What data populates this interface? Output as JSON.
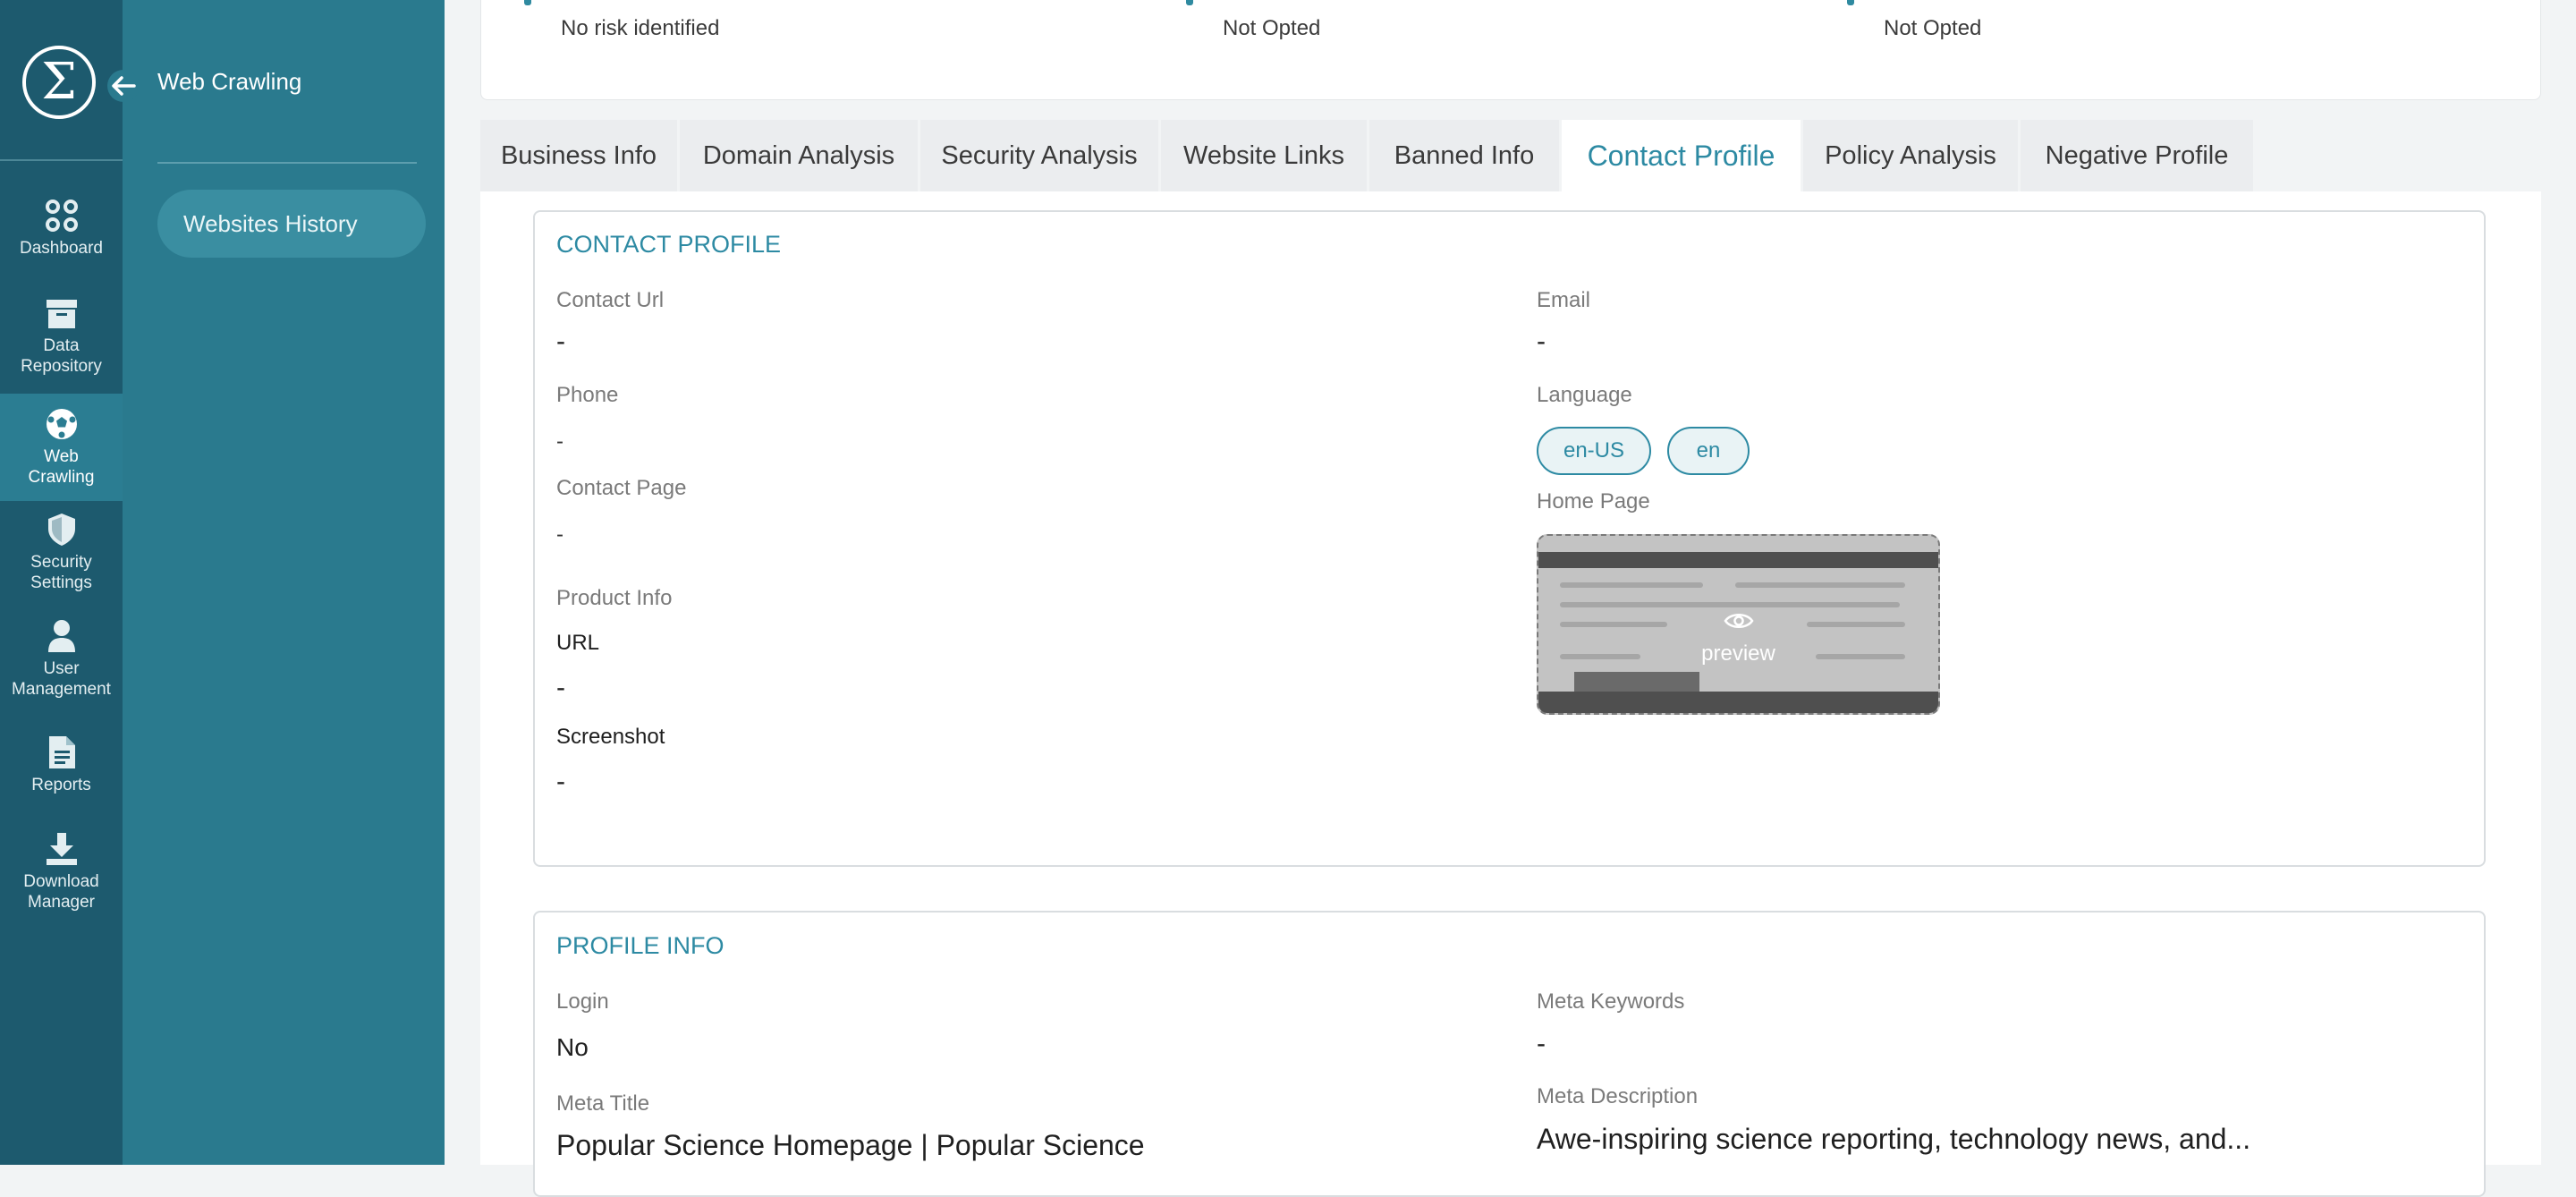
{
  "brand": {
    "logo_symbol": "Σ"
  },
  "rail": {
    "items": [
      {
        "label_1": "Dashboard",
        "label_2": "",
        "icon": "dashboard-icon"
      },
      {
        "label_1": "Data",
        "label_2": "Repository",
        "icon": "archive-icon"
      },
      {
        "label_1": "Web",
        "label_2": "Crawling",
        "icon": "soccer-ball-icon"
      },
      {
        "label_1": "Security",
        "label_2": "Settings",
        "icon": "shield-icon"
      },
      {
        "label_1": "User",
        "label_2": "Management",
        "icon": "user-icon"
      },
      {
        "label_1": "Reports",
        "label_2": "",
        "icon": "document-icon"
      },
      {
        "label_1": "Download",
        "label_2": "Manager",
        "icon": "download-icon"
      }
    ],
    "active": "Web Crawling"
  },
  "panel": {
    "title": "Web Crawling",
    "items": [
      {
        "label": "Websites History"
      }
    ]
  },
  "top_card": {
    "values": [
      "No risk identified",
      "Not Opted",
      "Not Opted"
    ]
  },
  "tabs": {
    "items": [
      "Business Info",
      "Domain Analysis",
      "Security Analysis",
      "Website Links",
      "Banned Info",
      "Contact Profile",
      "Policy Analysis",
      "Negative Profile"
    ],
    "active": "Contact Profile"
  },
  "contact_profile": {
    "title": "CONTACT PROFILE",
    "contact_url_label": "Contact Url",
    "contact_url_value": "-",
    "email_label": "Email",
    "email_value": "-",
    "phone_label": "Phone",
    "phone_value": "-",
    "language_label": "Language",
    "languages": [
      "en-US",
      "en"
    ],
    "contact_page_label": "Contact Page",
    "contact_page_value": "-",
    "home_page_label": "Home Page",
    "preview_label": "preview",
    "product_info_label": "Product Info",
    "url_label": "URL",
    "url_value": "-",
    "screenshot_label": "Screenshot",
    "screenshot_value": "-"
  },
  "profile_info": {
    "title": "PROFILE INFO",
    "login_label": "Login",
    "login_value": "No",
    "meta_keywords_label": "Meta Keywords",
    "meta_keywords_value": "-",
    "meta_title_label": "Meta Title",
    "meta_title_value": "Popular Science Homepage | Popular Science",
    "meta_description_label": "Meta Description",
    "meta_description_value": "Awe-inspiring science reporting, technology news, and..."
  },
  "colors": {
    "rail_bg": "#1d5a6e",
    "panel_bg": "#2a7a8e",
    "accent": "#2d8aa3"
  }
}
